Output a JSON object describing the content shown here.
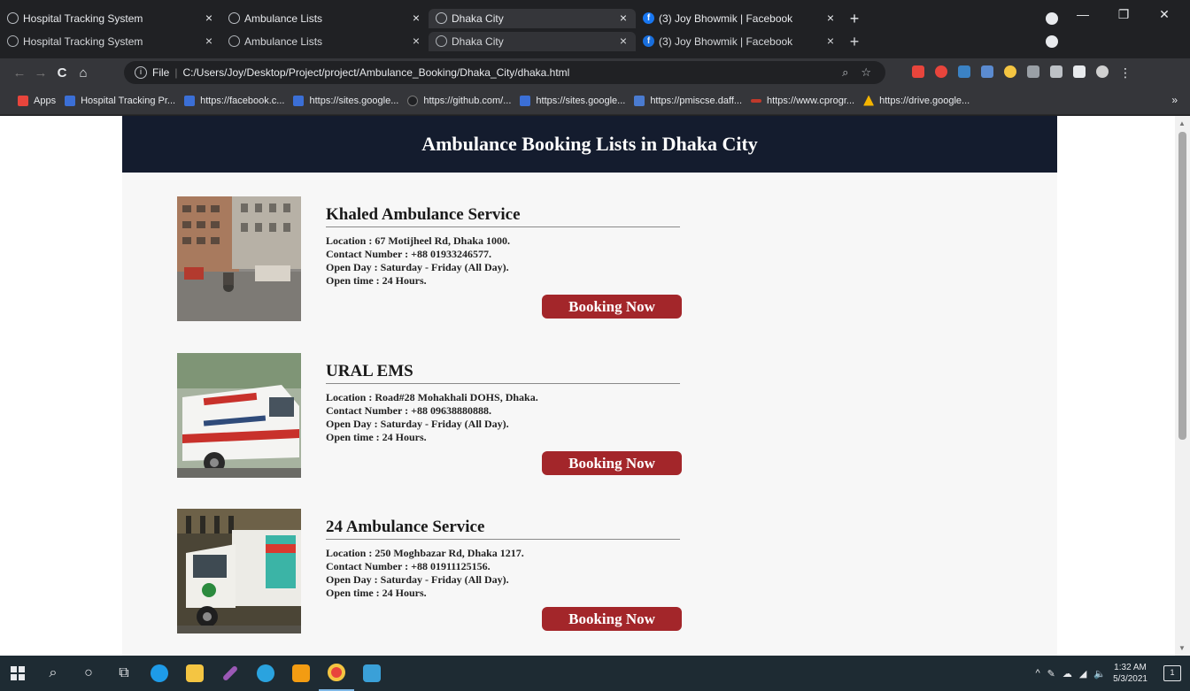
{
  "browser": {
    "tabs": [
      {
        "title": "Hospital Tracking System",
        "icon": "globe-icon",
        "active": false
      },
      {
        "title": "Ambulance Lists",
        "icon": "globe-icon",
        "active": false
      },
      {
        "title": "Dhaka City",
        "icon": "globe-icon",
        "active": true
      },
      {
        "title": "(3) Joy Bhowmik | Facebook",
        "icon": "facebook-icon",
        "active": false
      }
    ],
    "new_tab_symbol": "+",
    "tab_close_symbol": "×",
    "window_controls": {
      "minimize": "—",
      "restore": "❐",
      "close": "✕"
    },
    "address": {
      "scheme_label": "File",
      "url": "C:/Users/Joy/Desktop/Project/project/Ambulance_Booking/Dhaka_City/dhaka.html"
    },
    "nav": {
      "back": "←",
      "forward": "→",
      "reload": "C",
      "home": "⌂"
    },
    "bookmarks": [
      {
        "label": "Apps",
        "icon": "apps-grid-icon",
        "color": "#e8453c"
      },
      {
        "label": "Hospital Tracking Pr...",
        "icon": "sites-icon",
        "color": "#3b6fd6"
      },
      {
        "label": "https://facebook.c...",
        "icon": "sites-icon",
        "color": "#3b6fd6"
      },
      {
        "label": "https://sites.google...",
        "icon": "sites-icon",
        "color": "#3b6fd6"
      },
      {
        "label": "https://github.com/...",
        "icon": "github-icon",
        "color": "#555555"
      },
      {
        "label": "https://sites.google...",
        "icon": "sites-icon",
        "color": "#3b6fd6"
      },
      {
        "label": "https://pmiscse.daff...",
        "icon": "download-icon",
        "color": "#4a7bd0"
      },
      {
        "label": "https://www.cprogr...",
        "icon": "cprog-icon",
        "color": "#c0392b"
      },
      {
        "label": "https://drive.google...",
        "icon": "drive-icon",
        "color": "#f4b400"
      }
    ],
    "bookmarks_more": "»"
  },
  "page": {
    "title": "Ambulance Booking Lists in Dhaka City",
    "services": [
      {
        "name": "Khaled Ambulance Service",
        "location": "Location : 67 Motijheel Rd, Dhaka 1000.",
        "contact": "Contact Number : +88 01933246577.",
        "open_day": "Open Day : Saturday - Friday (All Day).",
        "open_time": "Open time : 24 Hours.",
        "button": "Booking Now"
      },
      {
        "name": "URAL EMS",
        "location": "Location : Road#28 Mohakhali DOHS, Dhaka.",
        "contact": "Contact Number : +88 09638880888.",
        "open_day": "Open Day : Saturday - Friday (All Day).",
        "open_time": "Open time : 24 Hours.",
        "button": "Booking Now"
      },
      {
        "name": "24 Ambulance Service",
        "location": "Location : 250 Moghbazar Rd, Dhaka 1217.",
        "contact": "Contact Number : +88 01911125156.",
        "open_day": "Open Day : Saturday - Friday (All Day).",
        "open_time": "Open time : 24 Hours.",
        "button": "Booking Now"
      }
    ]
  },
  "taskbar": {
    "time": "1:32 AM",
    "date": "5/3/2021",
    "apps": [
      {
        "name": "windows-start-icon",
        "color": "#e8eaed"
      },
      {
        "name": "search-icon",
        "color": "#e8eaed"
      },
      {
        "name": "cortana-icon",
        "color": "#e8eaed"
      },
      {
        "name": "task-view-icon",
        "color": "#e8eaed"
      },
      {
        "name": "edge-icon",
        "color": "#1e9be8"
      },
      {
        "name": "file-explorer-icon",
        "color": "#f4c542"
      },
      {
        "name": "pen-app-icon",
        "color": "#9b59b6"
      },
      {
        "name": "telegram-icon",
        "color": "#2aa3df"
      },
      {
        "name": "sublime-icon",
        "color": "#f39c12"
      },
      {
        "name": "chrome-icon",
        "color": "#e8453c"
      },
      {
        "name": "photos-icon",
        "color": "#3aa0d8"
      }
    ]
  }
}
